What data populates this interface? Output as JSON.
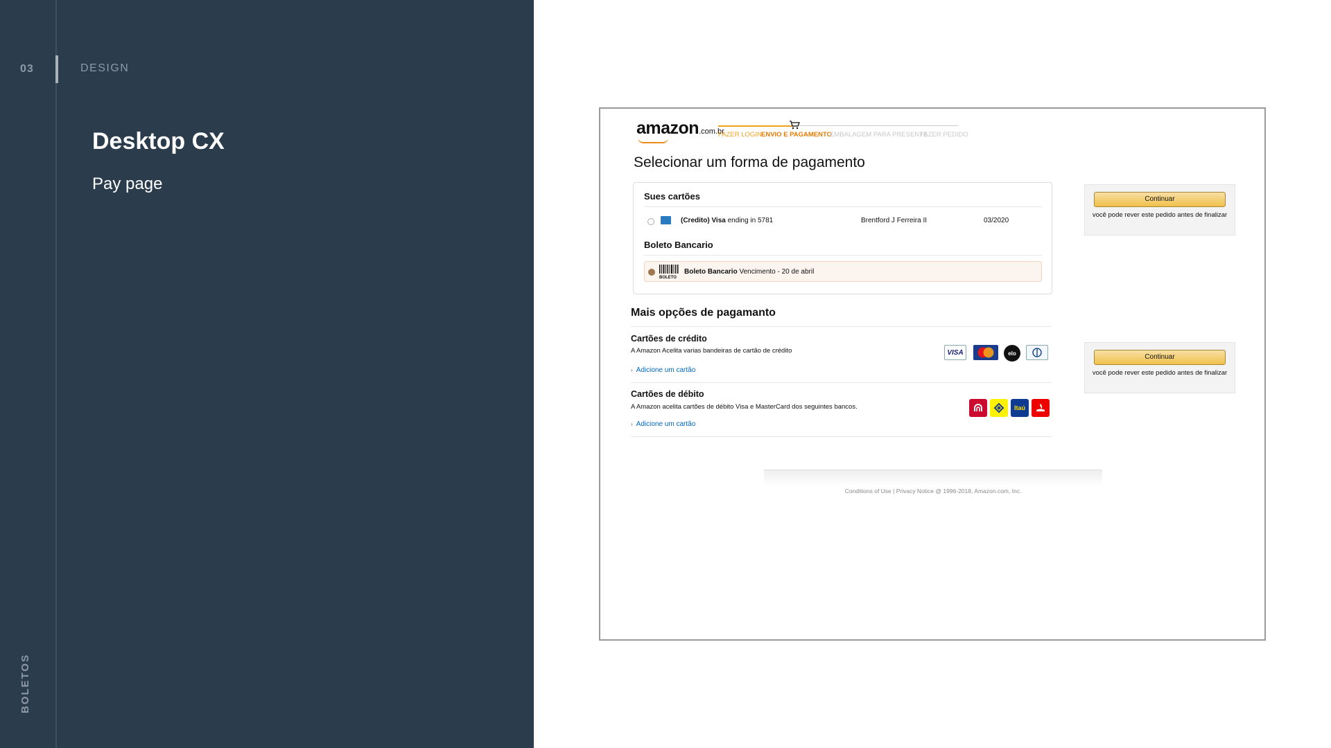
{
  "slide": {
    "section_number": "03",
    "section_label": "DESIGN",
    "title": "Desktop CX",
    "subtitle": "Pay page",
    "vertical_label": "BOLETOS"
  },
  "mockup": {
    "logo": {
      "text": "amazon",
      "suffix": ".com.br"
    },
    "checkout_steps": [
      {
        "label": "FAZER LOGIN",
        "state": "done"
      },
      {
        "label": "ENVIO E PAGAMENTO",
        "state": "current"
      },
      {
        "label": "EMBALAGEM PARA PRESENTE",
        "state": "todo"
      },
      {
        "label": "FAZER PEDIDO",
        "state": "todo"
      }
    ],
    "page_title": "Selecionar um forma de pagamento",
    "saved": {
      "cards_heading": "Sues cartões",
      "card": {
        "brand": "(Credito) Visa",
        "ending": "ending in 5781",
        "holder": "Brentford J Ferreira II",
        "expiry": "03/2020",
        "selected": false
      },
      "boleto_heading": "Boleto Bancario",
      "boleto": {
        "icon_text": "BOLETO",
        "name": "Boleto Bancario",
        "due": "Vencimento - 20 de abril",
        "selected": true
      }
    },
    "continue": {
      "button_label": "Continuar",
      "note": "você pode rever este pedido antes de finalizar"
    },
    "more_options": {
      "heading": "Mais opções de pagamanto",
      "credit": {
        "heading": "Cartões de crédito",
        "description": "A Amazon Acelita varias bandeiras de cartão de crédito",
        "link": "Adicione um cartão",
        "logos": [
          "VISA",
          "MasterCard",
          "elo",
          "Diners Club"
        ]
      },
      "debit": {
        "heading": "Cartões de débito",
        "description": "A Amazon acelita cartões de débito Visa e MasterCard dos seguintes bancos.",
        "link": "Adicione um cartão",
        "banks": [
          "Bradesco",
          "Banco do Brasil",
          "Itaú",
          "Santander"
        ]
      }
    },
    "footer": "Conditions of Use | Privacy Notice @ 1996-2018, Amazon.com, Inc."
  },
  "colors": {
    "slide_bg": "#2b3c4d",
    "accent_orange": "#f0a020",
    "button_yellow": "#f0c14b",
    "link_blue": "#0066c0"
  }
}
